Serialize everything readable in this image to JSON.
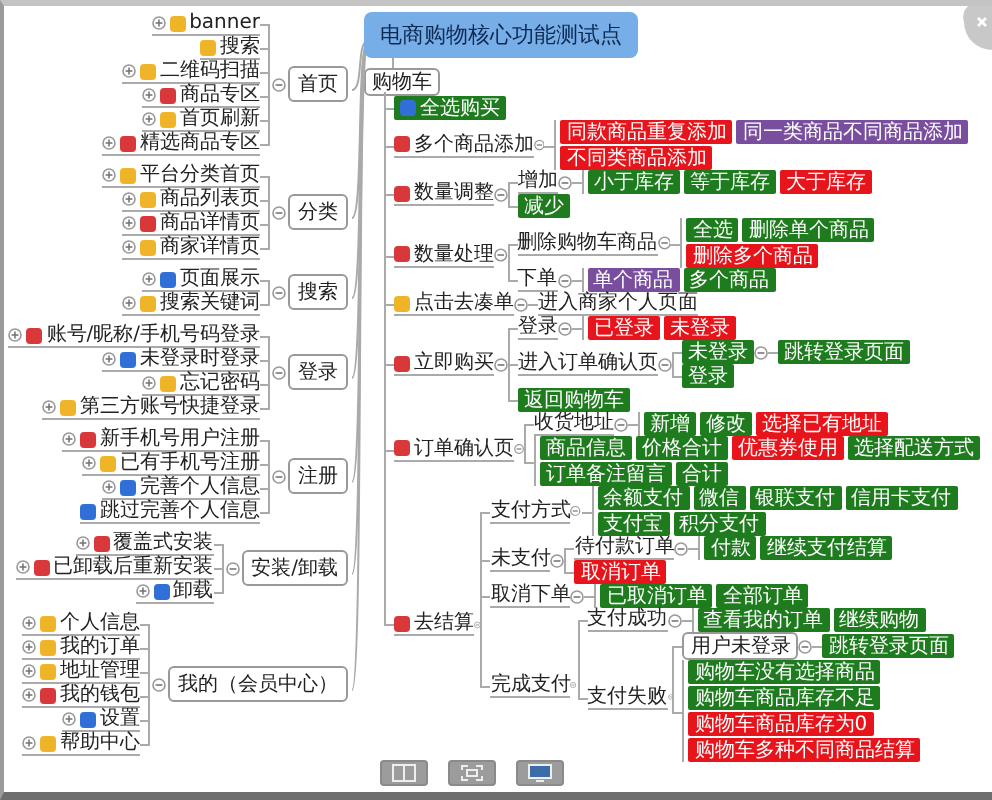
{
  "central_topic": {
    "text": "电商购物核心功能测试点"
  },
  "left_branches": [
    {
      "text": "首页",
      "children": [
        {
          "text": "banner",
          "marker": {
            "color": "#f0b429"
          },
          "collapsed": true
        },
        {
          "text": "搜索",
          "marker": {
            "color": "#f0b429"
          },
          "collapsed": false
        },
        {
          "text": "二维码扫描",
          "marker": {
            "color": "#f0b429"
          },
          "collapsed": true
        },
        {
          "text": "商品专区",
          "marker": {
            "color": "#d9383a"
          },
          "collapsed": true
        },
        {
          "text": "首页刷新",
          "marker": {
            "color": "#f0b429"
          },
          "collapsed": true
        },
        {
          "text": "精选商品专区",
          "marker": {
            "color": "#d9383a"
          },
          "collapsed": true
        }
      ]
    },
    {
      "text": "分类",
      "children": [
        {
          "text": "平台分类首页",
          "marker": {
            "color": "#f0b429"
          },
          "collapsed": true
        },
        {
          "text": "商品列表页",
          "marker": {
            "color": "#f0b429"
          },
          "collapsed": true
        },
        {
          "text": "商品详情页",
          "marker": {
            "color": "#d9383a"
          },
          "collapsed": true
        },
        {
          "text": "商家详情页",
          "marker": {
            "color": "#f0b429"
          },
          "collapsed": true
        }
      ]
    },
    {
      "text": "搜索",
      "children": [
        {
          "text": "页面展示",
          "marker": {
            "color": "#2f6fd6"
          },
          "collapsed": true
        },
        {
          "text": "搜索关键词",
          "marker": {
            "color": "#f0b429"
          },
          "collapsed": true
        }
      ]
    },
    {
      "text": "登录",
      "children": [
        {
          "text": "账号/昵称/手机号码登录",
          "marker": {
            "color": "#d9383a"
          },
          "collapsed": true
        },
        {
          "text": "未登录时登录",
          "marker": {
            "color": "#2f6fd6"
          },
          "collapsed": true
        },
        {
          "text": "忘记密码",
          "marker": {
            "color": "#f0b429"
          },
          "collapsed": true
        },
        {
          "text": "第三方账号快捷登录",
          "marker": {
            "color": "#f0b429"
          },
          "collapsed": true
        }
      ]
    },
    {
      "text": "注册",
      "children": [
        {
          "text": "新手机号用户注册",
          "marker": {
            "color": "#d9383a"
          },
          "collapsed": true
        },
        {
          "text": "已有手机号注册",
          "marker": {
            "color": "#f0b429"
          },
          "collapsed": true
        },
        {
          "text": "完善个人信息",
          "marker": {
            "color": "#2f6fd6"
          },
          "collapsed": true
        },
        {
          "text": "跳过完善个人信息",
          "marker": {
            "color": "#2f6fd6"
          },
          "collapsed": false
        }
      ]
    },
    {
      "text": "安装/卸载",
      "children": [
        {
          "text": "覆盖式安装",
          "marker": {
            "color": "#d9383a"
          },
          "collapsed": true
        },
        {
          "text": "已卸载后重新安装",
          "marker": {
            "color": "#d9383a"
          },
          "collapsed": true
        },
        {
          "text": "卸载",
          "marker": {
            "color": "#2f6fd6"
          },
          "collapsed": true
        }
      ]
    },
    {
      "text": "我的（会员中心）",
      "children": [
        {
          "text": "个人信息",
          "marker": {
            "color": "#f0b429"
          },
          "collapsed": true
        },
        {
          "text": "我的订单",
          "marker": {
            "color": "#f0b429"
          },
          "collapsed": true
        },
        {
          "text": "地址管理",
          "marker": {
            "color": "#f0b429"
          },
          "collapsed": true
        },
        {
          "text": "我的钱包",
          "marker": {
            "color": "#d9383a"
          },
          "collapsed": true
        },
        {
          "text": "设置",
          "marker": {
            "color": "#2f6fd6"
          },
          "collapsed": true
        },
        {
          "text": "帮助中心",
          "marker": {
            "color": "#f0b429"
          },
          "collapsed": true
        }
      ]
    }
  ],
  "right_branch": {
    "text": "购物车",
    "kind": "box",
    "children": [
      {
        "text": "全选购买",
        "kind": "tag",
        "color": "#1e7b1e",
        "marker": {
          "color": "#2f6fd6"
        }
      },
      {
        "text": "多个商品添加",
        "kind": "topic",
        "marker": {
          "color": "#d9383a"
        },
        "children": [
          {
            "text": "同款商品重复添加",
            "kind": "tag",
            "color": "#e8141b"
          },
          {
            "text": "同一类商品不同商品添加",
            "kind": "tag",
            "color": "#7a4e9e"
          },
          {
            "text": "不同类商品添加",
            "kind": "tag",
            "color": "#e8141b"
          }
        ]
      },
      {
        "text": "数量调整",
        "kind": "topic",
        "marker": {
          "color": "#d9383a"
        },
        "children": [
          {
            "text": "增加",
            "kind": "topic",
            "children": [
              {
                "text": "小于库存",
                "kind": "tag",
                "color": "#1e7b1e"
              },
              {
                "text": "等于库存",
                "kind": "tag",
                "color": "#1e7b1e"
              },
              {
                "text": "大于库存",
                "kind": "tag",
                "color": "#e8141b"
              }
            ]
          },
          {
            "text": "减少",
            "kind": "tag",
            "color": "#1e7b1e"
          }
        ]
      },
      {
        "text": "数量处理",
        "kind": "topic",
        "marker": {
          "color": "#d9383a"
        },
        "children": [
          {
            "text": "删除购物车商品",
            "kind": "topic",
            "children": [
              {
                "text": "全选",
                "kind": "tag",
                "color": "#1e7b1e"
              },
              {
                "text": "删除单个商品",
                "kind": "tag",
                "color": "#1e7b1e"
              },
              {
                "text": "删除多个商品",
                "kind": "tag",
                "color": "#e8141b"
              }
            ]
          },
          {
            "text": "下单",
            "kind": "topic",
            "children": [
              {
                "text": "单个商品",
                "kind": "tag",
                "color": "#7a4e9e"
              },
              {
                "text": "多个商品",
                "kind": "tag",
                "color": "#1e7b1e"
              }
            ]
          }
        ]
      },
      {
        "text": "点击去凑单",
        "kind": "topic",
        "marker": {
          "color": "#f0b429"
        },
        "children": [
          {
            "text": "进入商家个人页面",
            "kind": "topic"
          }
        ]
      },
      {
        "text": "立即购买",
        "kind": "topic",
        "marker": {
          "color": "#d9383a"
        },
        "children": [
          {
            "text": "登录",
            "kind": "topic",
            "children": [
              {
                "text": "已登录",
                "kind": "tag",
                "color": "#e8141b"
              },
              {
                "text": "未登录",
                "kind": "tag",
                "color": "#e8141b"
              }
            ]
          },
          {
            "text": "进入订单确认页",
            "kind": "topic",
            "children": [
              {
                "text": "未登录",
                "kind": "tag",
                "color": "#1e7b1e",
                "children": [
                  {
                    "text": "跳转登录页面",
                    "kind": "tag",
                    "color": "#1e7b1e"
                  }
                ]
              },
              {
                "text": "登录",
                "kind": "tag",
                "color": "#1e7b1e"
              }
            ]
          },
          {
            "text": "返回购物车",
            "kind": "tag",
            "color": "#1e7b1e"
          }
        ]
      },
      {
        "text": "订单确认页",
        "kind": "topic",
        "marker": {
          "color": "#d9383a"
        },
        "children": [
          {
            "text": "收货地址",
            "kind": "topic",
            "children": [
              {
                "text": "新增",
                "kind": "tag",
                "color": "#1e7b1e"
              },
              {
                "text": "修改",
                "kind": "tag",
                "color": "#1e7b1e"
              },
              {
                "text": "选择已有地址",
                "kind": "tag",
                "color": "#e8141b"
              }
            ]
          },
          {
            "text": "商品信息",
            "kind": "tag",
            "color": "#1e7b1e"
          },
          {
            "text": "价格合计",
            "kind": "tag",
            "color": "#1e7b1e"
          },
          {
            "text": "优惠券使用",
            "kind": "tag",
            "color": "#e8141b"
          },
          {
            "text": "选择配送方式",
            "kind": "tag",
            "color": "#1e7b1e"
          },
          {
            "text": "订单备注留言",
            "kind": "tag",
            "color": "#1e7b1e"
          },
          {
            "text": "合计",
            "kind": "tag",
            "color": "#1e7b1e"
          }
        ]
      },
      {
        "text": "去结算",
        "kind": "topic",
        "marker": {
          "color": "#d9383a"
        },
        "children": [
          {
            "text": "支付方式",
            "kind": "topic",
            "children": [
              {
                "text": "余额支付",
                "kind": "tag",
                "color": "#1e7b1e"
              },
              {
                "text": "微信",
                "kind": "tag",
                "color": "#1e7b1e"
              },
              {
                "text": "银联支付",
                "kind": "tag",
                "color": "#1e7b1e"
              },
              {
                "text": "信用卡支付",
                "kind": "tag",
                "color": "#1e7b1e"
              },
              {
                "text": "支付宝",
                "kind": "tag",
                "color": "#1e7b1e"
              },
              {
                "text": "积分支付",
                "kind": "tag",
                "color": "#1e7b1e"
              }
            ]
          },
          {
            "text": "未支付",
            "kind": "topic",
            "children": [
              {
                "text": "待付款订单",
                "kind": "topic",
                "children": [
                  {
                    "text": "付款",
                    "kind": "tag",
                    "color": "#1e7b1e"
                  },
                  {
                    "text": "继续支付结算",
                    "kind": "tag",
                    "color": "#1e7b1e"
                  }
                ]
              },
              {
                "text": "取消订单",
                "kind": "tag",
                "color": "#e8141b"
              }
            ]
          },
          {
            "text": "取消下单",
            "kind": "topic",
            "children": [
              {
                "text": "已取消订单",
                "kind": "tag",
                "color": "#1e7b1e"
              },
              {
                "text": "全部订单",
                "kind": "tag",
                "color": "#1e7b1e"
              }
            ]
          },
          {
            "text": "完成支付",
            "kind": "topic",
            "children": [
              {
                "text": "支付成功",
                "kind": "topic",
                "children": [
                  {
                    "text": "查看我的订单",
                    "kind": "tag",
                    "color": "#1e7b1e"
                  },
                  {
                    "text": "继续购物",
                    "kind": "tag",
                    "color": "#1e7b1e"
                  }
                ]
              },
              {
                "text": "支付失败",
                "kind": "topic",
                "children": [
                  {
                    "text": "用户未登录",
                    "kind": "box",
                    "children": [
                      {
                        "text": "跳转登录页面",
                        "kind": "tag",
                        "color": "#1e7b1e"
                      }
                    ]
                  },
                  {
                    "text": "购物车没有选择商品",
                    "kind": "tag",
                    "color": "#1e7b1e"
                  },
                  {
                    "text": "购物车商品库存不足",
                    "kind": "tag",
                    "color": "#1e7b1e"
                  },
                  {
                    "text": "购物车商品库存为0",
                    "kind": "tag",
                    "color": "#e8141b"
                  },
                  {
                    "text": "购物车多种不同商品结算",
                    "kind": "tag",
                    "color": "#e8141b"
                  }
                ]
              }
            ]
          }
        ]
      }
    ]
  }
}
